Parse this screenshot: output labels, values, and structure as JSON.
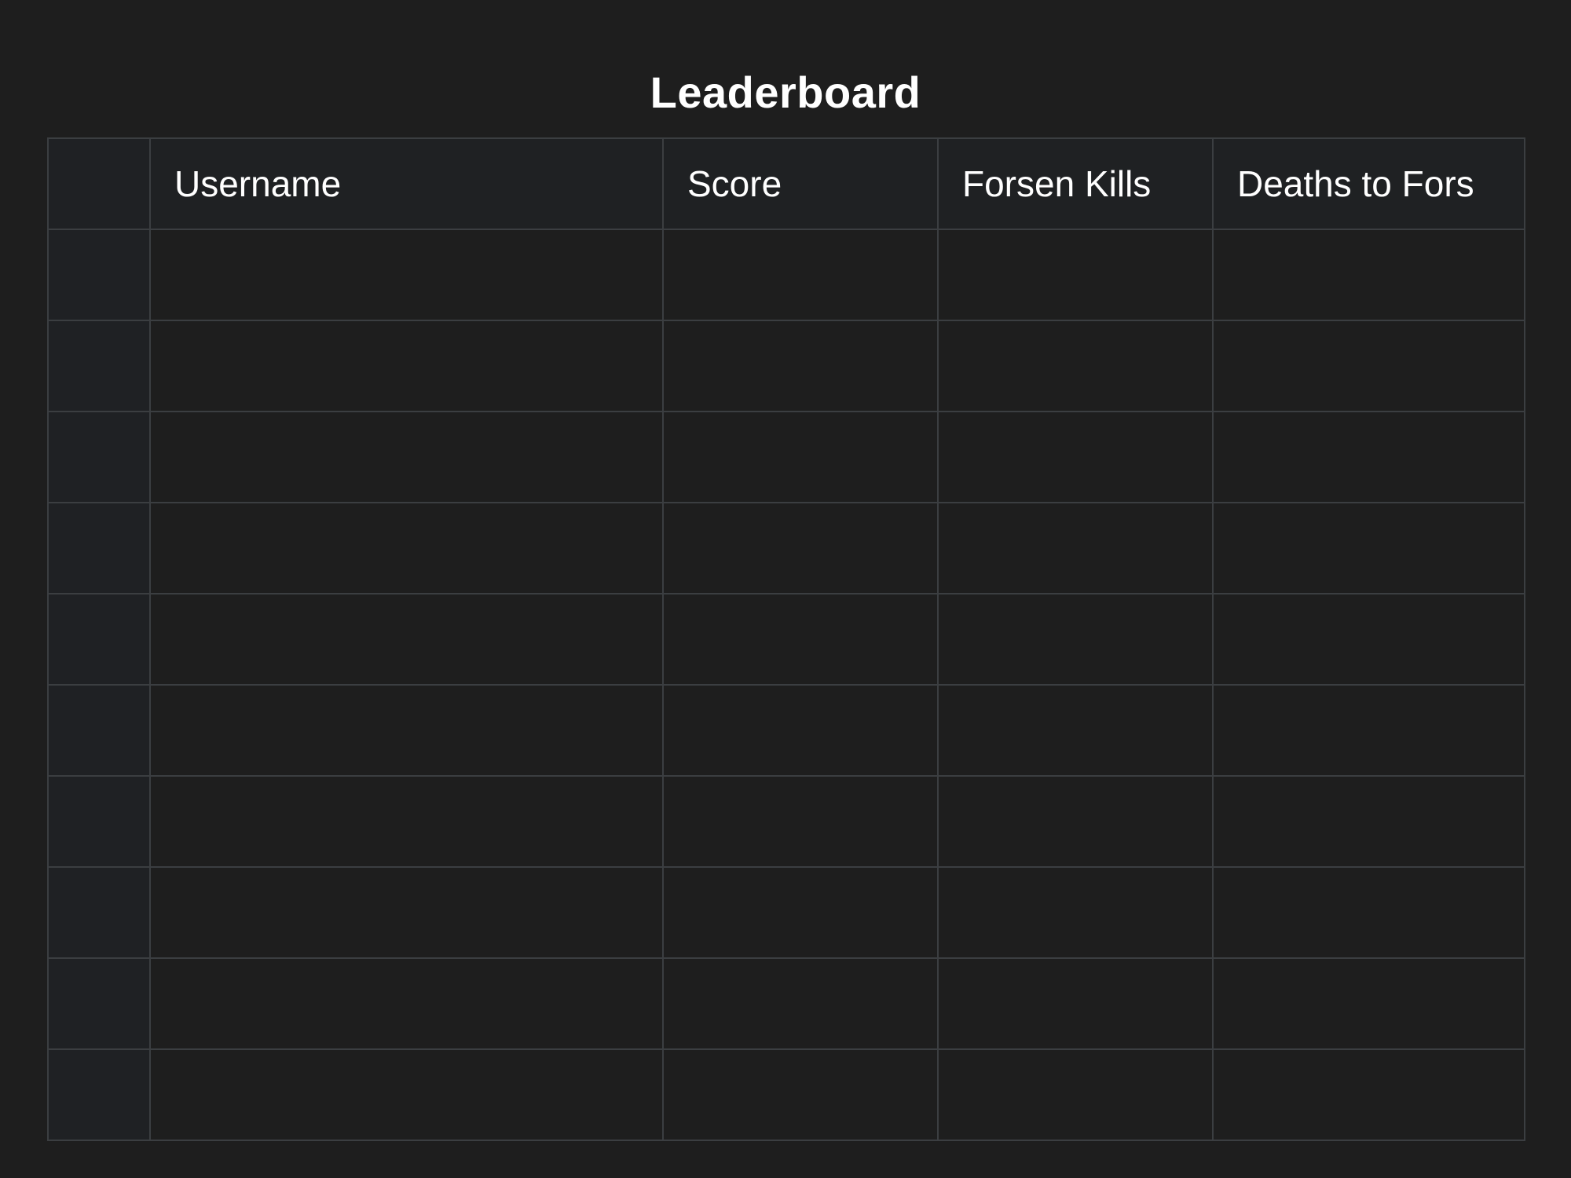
{
  "page": {
    "title": "Leaderboard"
  },
  "table": {
    "columns": [
      "",
      "Username",
      "Score",
      "Forsen Kills",
      "Deaths to Fors"
    ],
    "rows": [
      [
        "",
        "",
        "",
        "",
        ""
      ],
      [
        "",
        "",
        "",
        "",
        ""
      ],
      [
        "",
        "",
        "",
        "",
        ""
      ],
      [
        "",
        "",
        "",
        "",
        ""
      ],
      [
        "",
        "",
        "",
        "",
        ""
      ],
      [
        "",
        "",
        "",
        "",
        ""
      ],
      [
        "",
        "",
        "",
        "",
        ""
      ],
      [
        "",
        "",
        "",
        "",
        ""
      ],
      [
        "",
        "",
        "",
        "",
        ""
      ],
      [
        "",
        "",
        "",
        "",
        ""
      ]
    ]
  },
  "colors": {
    "background": "#1e1e1e",
    "header_background": "#1f2123",
    "border": "#3b3e41",
    "text": "#ffffff"
  }
}
